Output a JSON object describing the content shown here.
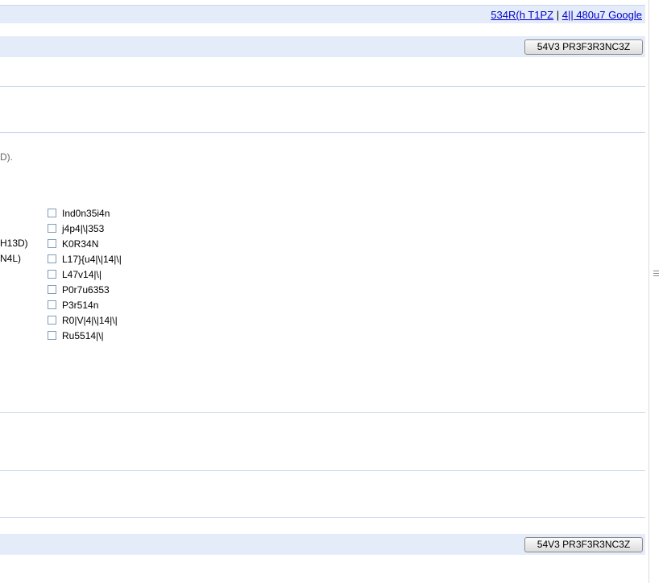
{
  "top_links": {
    "search_tips": "534R(h T1PZ",
    "separator": "|",
    "about_google": "4|| 480u7 Google"
  },
  "save_button_top": "54V3 PR3F3R3NC3Z",
  "save_button_bottom": "54V3 PR3F3R3NC3Z",
  "truncated_text": {
    "line1": "D).",
    "line2": "H13D)",
    "line3": "N4L)"
  },
  "languages": [
    "Ind0n35i4n",
    "j4p4|\\|353",
    "K0R34N",
    "L17}{u4|\\|14|\\|",
    "L47v14|\\|",
    "P0r7u6353",
    "P3r514n",
    "R0|V|4|\\|14|\\|",
    "Ru5514|\\|"
  ]
}
